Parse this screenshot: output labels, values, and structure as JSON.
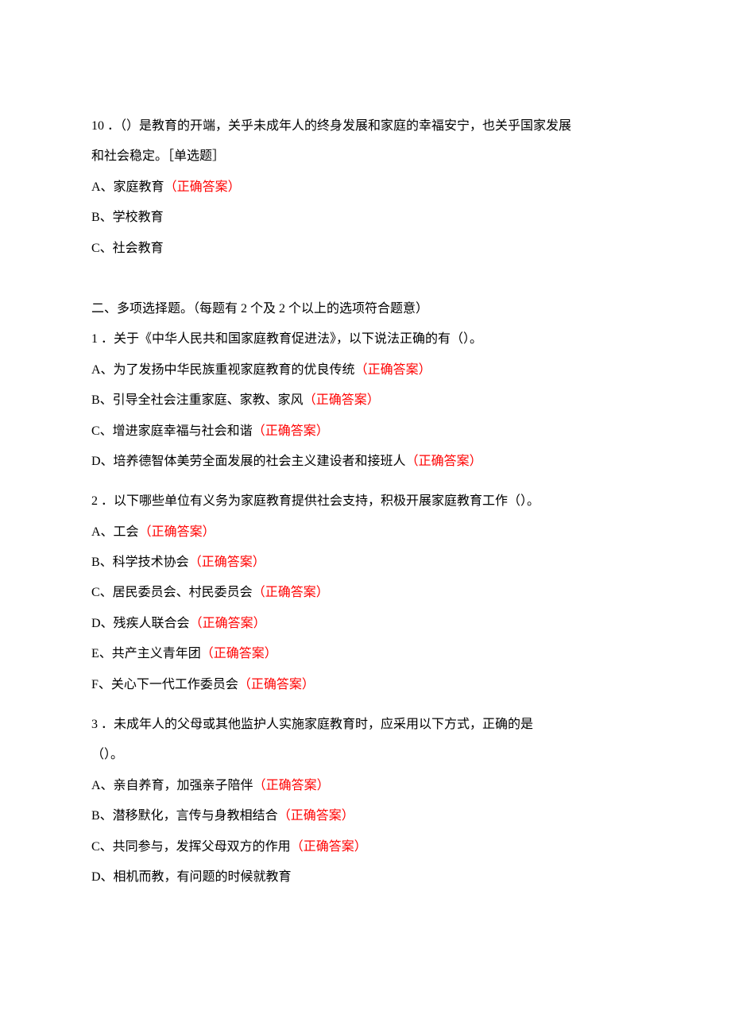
{
  "q10": {
    "stem_l1": "10 ．（）是教育的开端，关乎未成年人的终身发展和家庭的幸福安宁，也关乎国家发展",
    "stem_l2": "和社会稳定。［单选题］",
    "A": "A、家庭教育",
    "B": "B、学校教育",
    "C": "C、社会教育"
  },
  "section2": "二、多项选择题。（每题有 2 个及 2 个以上的选项符合题意）",
  "mq1": {
    "stem": "1 ．关于《中华人民共和国家庭教育促进法》，以下说法正确的有（）。",
    "A": "A、为了发扬中华民族重视家庭教育的优良传统",
    "B": "B、引导全社会注重家庭、家教、家风",
    "C": "C、增进家庭幸福与社会和谐",
    "D": "D、培养德智体美劳全面发展的社会主义建设者和接班人"
  },
  "mq2": {
    "stem": "2 ．以下哪些单位有义务为家庭教育提供社会支持，积极开展家庭教育工作（）。",
    "A": "A、工会",
    "B": "B、科学技术协会",
    "C": "C、居民委员会、村民委员会",
    "D": "D、残疾人联合会",
    "E": "E、共产主义青年团",
    "F": "F、关心下一代工作委员会"
  },
  "mq3": {
    "stem_l1": "3 ．未成年人的父母或其他监护人实施家庭教育时，应采用以下方式，正确的是",
    "stem_l2": "（）。",
    "A": "A、亲自养育，加强亲子陪伴",
    "B": "B、潜移默化，言传与身教相结合",
    "C": "C、共同参与，发挥父母双方的作用",
    "D": "D、相机而教，有问题的时候就教育"
  },
  "correct_label": "（正确答案）"
}
